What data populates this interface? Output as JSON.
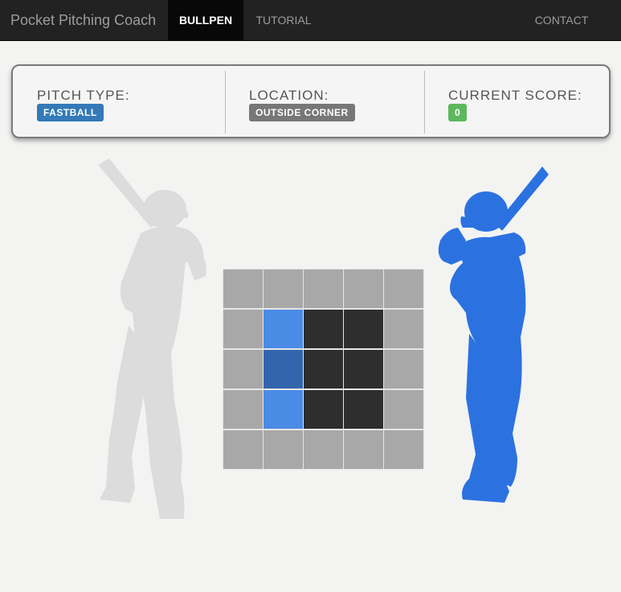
{
  "navbar": {
    "brand": "Pocket Pitching Coach",
    "items": [
      {
        "label": "BULLPEN",
        "active": true
      },
      {
        "label": "TUTORIAL",
        "active": false
      },
      {
        "label": "CONTACT",
        "active": false
      }
    ]
  },
  "info": {
    "pitch_type": {
      "label": "PITCH TYPE:",
      "value": "FASTBALL",
      "color": "#337ab7"
    },
    "location": {
      "label": "LOCATION:",
      "value": "OUTSIDE CORNER",
      "color": "#777777"
    },
    "score": {
      "label": "CURRENT SCORE:",
      "value": "0",
      "color": "#5cb85c"
    }
  },
  "strike_zone": {
    "rows": 5,
    "cols": 5,
    "cells": [
      [
        "out",
        "out",
        "out",
        "out",
        "out"
      ],
      [
        "out",
        "highlight",
        "strike",
        "strike",
        "out"
      ],
      [
        "out",
        "selected",
        "strike",
        "strike",
        "out"
      ],
      [
        "out",
        "highlight",
        "strike",
        "strike",
        "out"
      ],
      [
        "out",
        "out",
        "out",
        "out",
        "out"
      ]
    ]
  },
  "batters": {
    "left": {
      "state": "inactive",
      "color": "#dcdcdc"
    },
    "right": {
      "state": "active",
      "color": "#2b72e0"
    }
  }
}
